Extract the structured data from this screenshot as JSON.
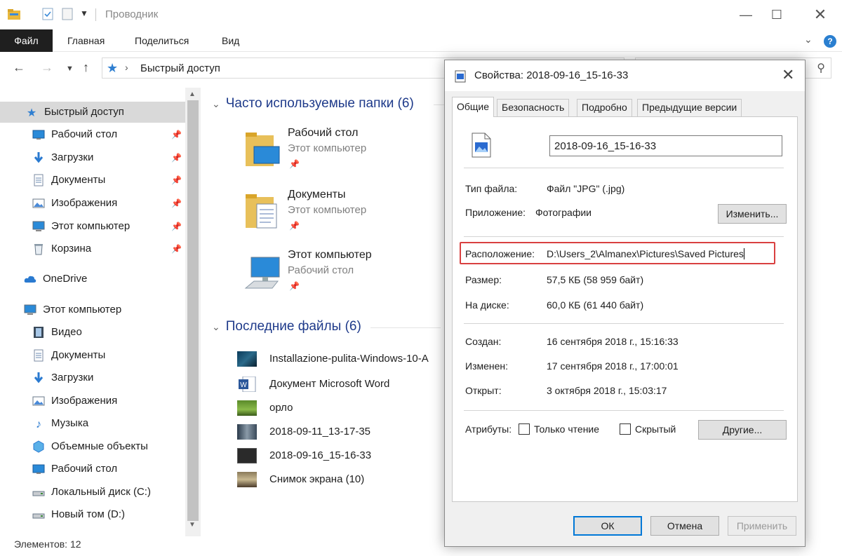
{
  "window": {
    "title": "Проводник",
    "ribbon_tabs": [
      "Файл",
      "Главная",
      "Поделиться",
      "Вид"
    ],
    "address": "Быстрый доступ"
  },
  "sidebar": {
    "items": [
      {
        "label": "Быстрый доступ",
        "icon": "star-icon",
        "pinned": false,
        "selected": true
      },
      {
        "label": "Рабочий стол",
        "icon": "desktop-icon",
        "pinned": true
      },
      {
        "label": "Загрузки",
        "icon": "download-icon",
        "pinned": true
      },
      {
        "label": "Документы",
        "icon": "document-icon",
        "pinned": true
      },
      {
        "label": "Изображения",
        "icon": "pictures-icon",
        "pinned": true
      },
      {
        "label": "Этот компьютер",
        "icon": "computer-icon",
        "pinned": true
      },
      {
        "label": "Корзина",
        "icon": "recycle-bin-icon",
        "pinned": true
      },
      {
        "label": "OneDrive",
        "icon": "cloud-icon",
        "pinned": false
      },
      {
        "label": "Этот компьютер",
        "icon": "computer-icon",
        "pinned": false
      },
      {
        "label": "Видео",
        "icon": "video-icon",
        "pinned": false
      },
      {
        "label": "Документы",
        "icon": "document-icon",
        "pinned": false
      },
      {
        "label": "Загрузки",
        "icon": "download-icon",
        "pinned": false
      },
      {
        "label": "Изображения",
        "icon": "pictures-icon",
        "pinned": false
      },
      {
        "label": "Музыка",
        "icon": "music-icon",
        "pinned": false
      },
      {
        "label": "Объемные объекты",
        "icon": "3d-objects-icon",
        "pinned": false
      },
      {
        "label": "Рабочий стол",
        "icon": "desktop-icon",
        "pinned": false
      },
      {
        "label": "Локальный диск (C:)",
        "icon": "drive-icon",
        "pinned": false
      },
      {
        "label": "Новый том (D:)",
        "icon": "drive-icon",
        "pinned": false
      }
    ]
  },
  "content": {
    "frequent_header": "Часто используемые папки (6)",
    "frequent": [
      {
        "name": "Рабочий стол",
        "sub": "Этот компьютер"
      },
      {
        "name": "Документы",
        "sub": "Этот компьютер"
      },
      {
        "name": "Этот компьютер",
        "sub": "Рабочий стол"
      }
    ],
    "recent_header": "Последние файлы (6)",
    "recent": [
      "Installazione-pulita-Windows-10-A",
      "Документ Microsoft Word",
      "орло",
      "2018-09-11_13-17-35",
      "2018-09-16_15-16-33",
      "Снимок экрана (10)"
    ]
  },
  "status": {
    "items_count": "Элементов: 12"
  },
  "dialog": {
    "title": "Свойства: 2018-09-16_15-16-33",
    "tabs": [
      "Общие",
      "Безопасность",
      "Подробно",
      "Предыдущие версии"
    ],
    "file_name": "2018-09-16_15-16-33",
    "file_type_label": "Тип файла:",
    "file_type_value": "Файл \"JPG\" (.jpg)",
    "app_label": "Приложение:",
    "app_value": "Фотографии",
    "change_button": "Изменить...",
    "location_label": "Расположение:",
    "location_value": "D:\\Users_2\\Almanex\\Pictures\\Saved Pictures",
    "size_label": "Размер:",
    "size_value": "57,5 КБ (58 959 байт)",
    "disk_label": "На диске:",
    "disk_value": "60,0 КБ (61 440 байт)",
    "created_label": "Создан:",
    "created_value": "16 сентября 2018 г., 15:16:33",
    "modified_label": "Изменен:",
    "modified_value": "17 сентября 2018 г., 17:00:01",
    "opened_label": "Открыт:",
    "opened_value": "3 октября 2018 г., 15:03:17",
    "attributes_label": "Атрибуты:",
    "readonly_label": "Только чтение",
    "hidden_label": "Скрытый",
    "other_button": "Другие...",
    "ok_button": "ОК",
    "cancel_button": "Отмена",
    "apply_button": "Применить"
  }
}
